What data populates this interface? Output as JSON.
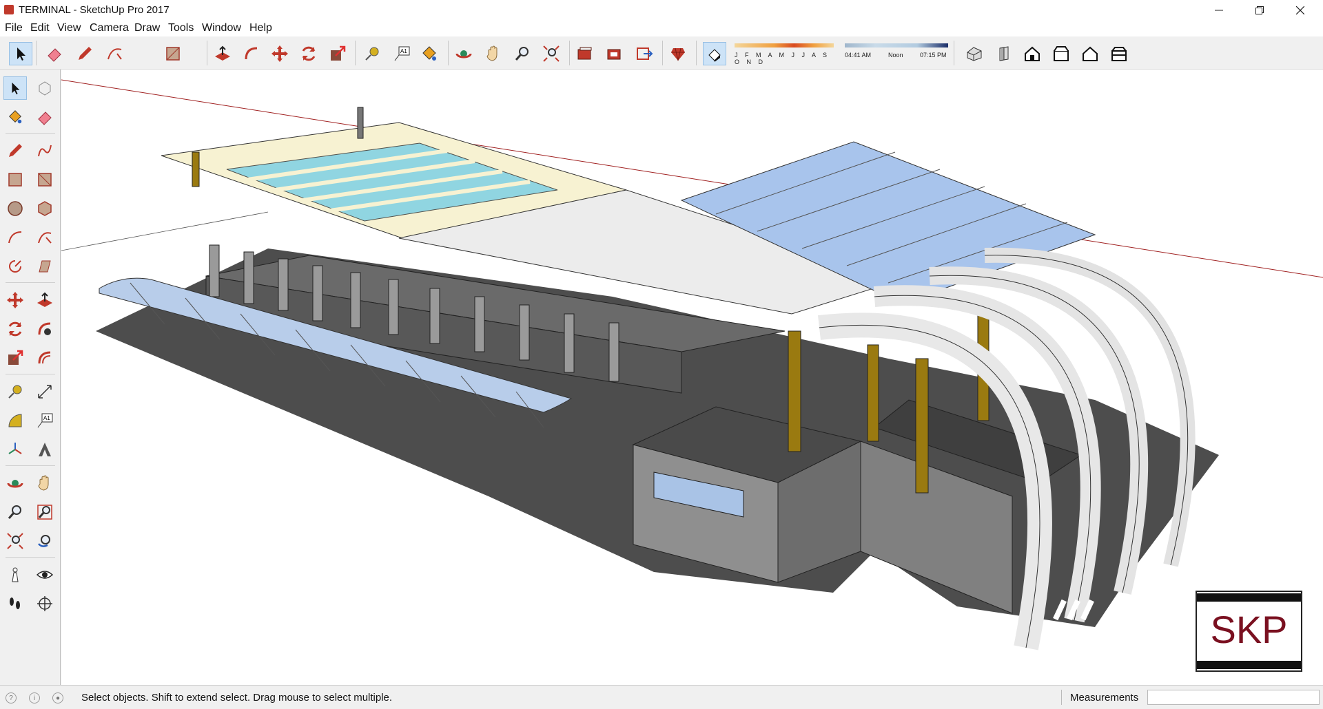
{
  "window": {
    "title": "TERMINAL - SketchUp Pro 2017",
    "controls": [
      "minimize-icon",
      "restore-icon",
      "close-icon"
    ]
  },
  "menu": [
    "File",
    "Edit",
    "View",
    "Camera",
    "Draw",
    "Tools",
    "Window",
    "Help"
  ],
  "toolbar": {
    "tools": [
      "select-icon",
      "eraser-icon",
      "pencil-icon",
      "arc-icon",
      "rectangle-icon",
      "push-pull-icon",
      "offset-icon",
      "move-icon",
      "rotate-icon",
      "scale-icon",
      "tape-measure-icon",
      "text-icon",
      "paint-bucket-icon",
      "orbit-icon",
      "pan-icon",
      "zoom-icon",
      "zoom-extents-icon",
      "warehouse-icon",
      "extension-warehouse-icon",
      "send-to-layout-icon",
      "ruby-icon",
      "shadows-toggle-icon",
      "iso-view-icon",
      "front-view-icon",
      "home-icon",
      "top-view-icon",
      "house-outline-icon",
      "section-icon"
    ],
    "months_label": "J F M A M J J A S O N D",
    "time_start": "04:41 AM",
    "time_mid": "Noon",
    "time_end": "07:15 PM"
  },
  "left_toolbar": [
    "select-icon",
    "make-component-icon",
    "paint-bucket-icon",
    "eraser-icon",
    "pencil-icon",
    "freehand-icon",
    "rectangle-icon",
    "rotated-rectangle-icon",
    "circle-icon",
    "polygon-icon",
    "arc-icon",
    "two-point-arc-icon",
    "pie-icon",
    "follow-me-icon",
    "move-icon",
    "push-pull-icon",
    "rotate-icon",
    "follow-me-rotate-icon",
    "scale-icon",
    "offset-icon",
    "tape-measure-icon",
    "dimension-icon",
    "protractor-icon",
    "text-icon",
    "axes-icon",
    "3d-text-icon",
    "orbit-icon",
    "pan-icon",
    "zoom-icon",
    "zoom-window-icon",
    "zoom-extents-icon",
    "previous-view-icon",
    "position-camera-icon",
    "look-around-icon",
    "walk-icon",
    "section-plane-icon"
  ],
  "status": {
    "message": "Select objects. Shift to extend select. Drag mouse to select multiple.",
    "measurements_label": "Measurements",
    "measurements_value": ""
  },
  "watermark": {
    "text": "SKP"
  }
}
